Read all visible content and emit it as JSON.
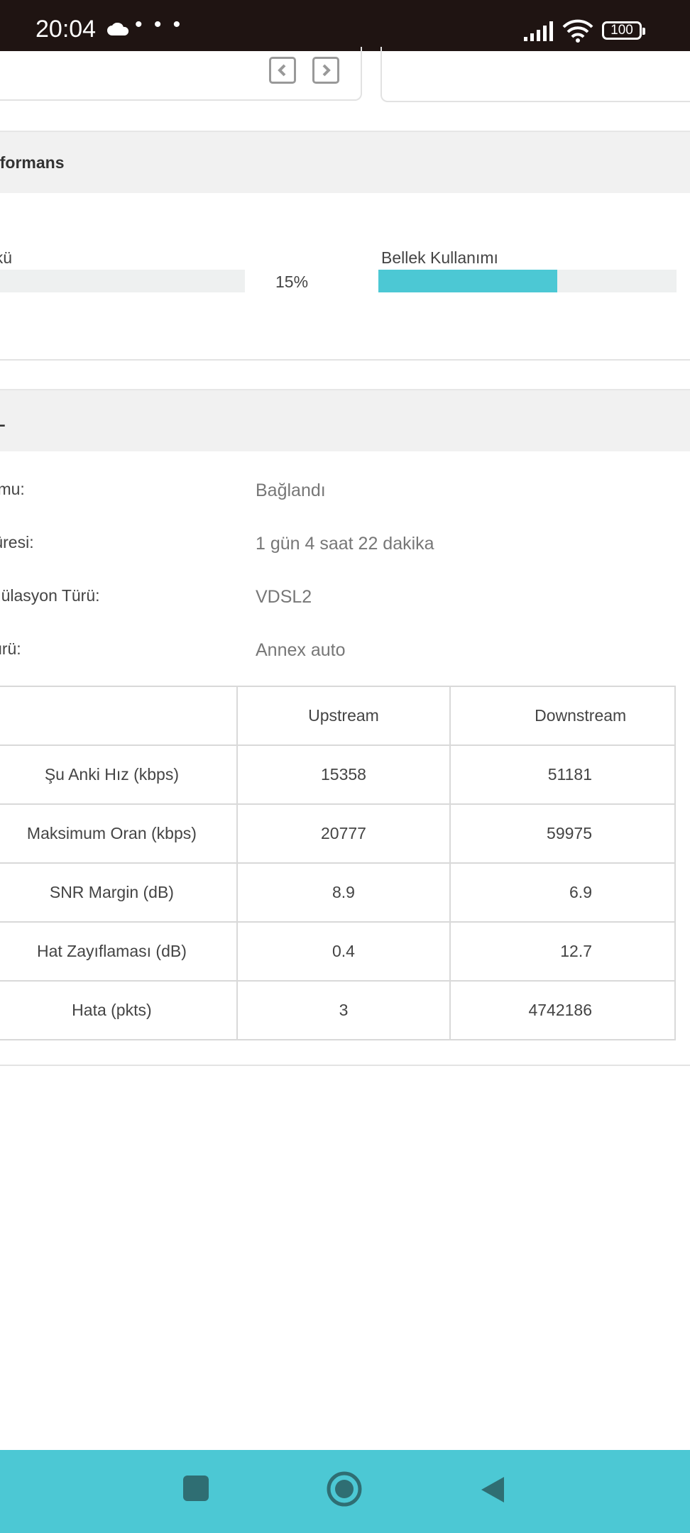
{
  "status_bar": {
    "time": "20:04",
    "dots": "• • •",
    "battery": "100"
  },
  "performance": {
    "header": "erformans",
    "cpu_label": "ükü",
    "cpu_value": "15%",
    "memory_label": "Bellek Kullanımı",
    "memory_usage_fraction": 0.6
  },
  "dsl": {
    "header": "SL",
    "rows": [
      {
        "label": "rumu:",
        "value": "Bağlandı"
      },
      {
        "label": " Süresi:",
        "value": "1 gün 4 saat 22 dakika"
      },
      {
        "label": "odülasyon Türü:",
        "value": "VDSL2"
      },
      {
        "label": "Türü:",
        "value": "Annex auto"
      }
    ],
    "table": {
      "headers": [
        "",
        "Upstream",
        "Downstream"
      ],
      "rows": [
        [
          "Şu Anki Hız (kbps)",
          "15358",
          "51181"
        ],
        [
          "Maksimum Oran (kbps)",
          "20777",
          "59975"
        ],
        [
          "SNR Margin (dB)",
          "8.9",
          "6.9"
        ],
        [
          "Hat Zayıflaması (dB)",
          "0.4",
          "12.7"
        ],
        [
          "Hata (pkts)",
          "3",
          "4742186"
        ]
      ]
    }
  },
  "icons": {
    "prev": "chevron-left-icon",
    "next": "chevron-right-icon",
    "recent": "square-icon",
    "home": "circle-icon",
    "back": "triangle-back-icon"
  },
  "colors": {
    "accent": "#4cc8d4",
    "status_bar": "#1f1412"
  }
}
